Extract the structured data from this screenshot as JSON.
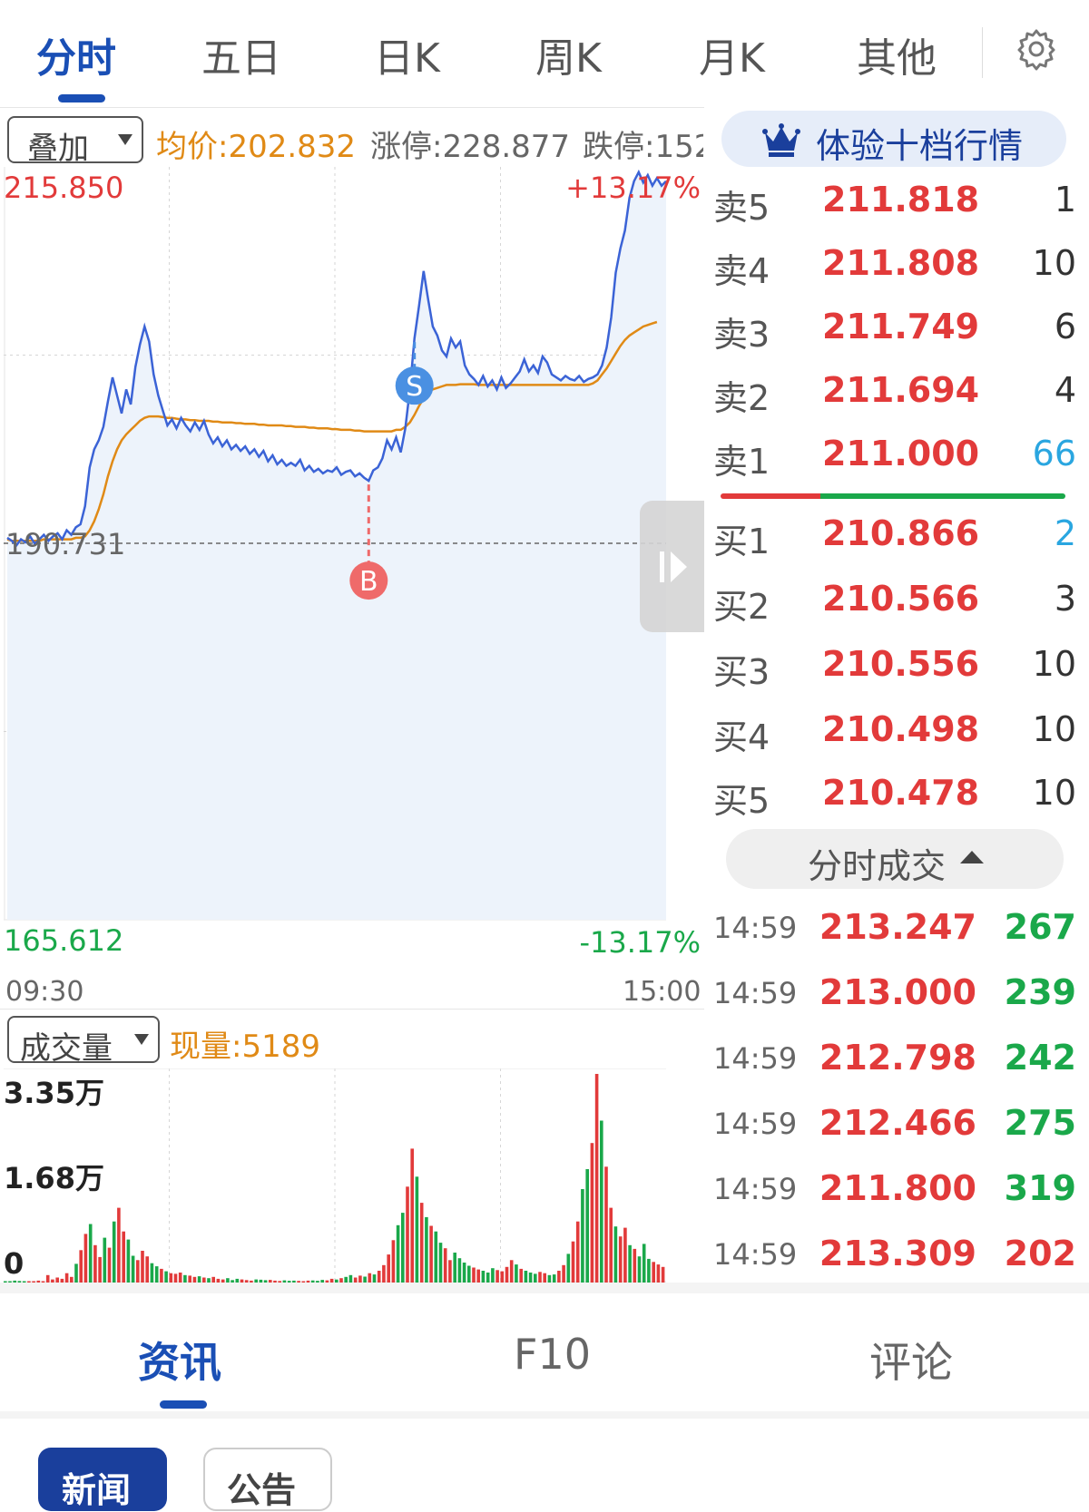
{
  "top_tabs": [
    {
      "label": "分时",
      "active": true
    },
    {
      "label": "五日",
      "active": false
    },
    {
      "label": "日K",
      "active": false
    },
    {
      "label": "周K",
      "active": false
    },
    {
      "label": "月K",
      "active": false
    },
    {
      "label": "其他",
      "active": false
    }
  ],
  "settings_icon": "gear-icon",
  "header": {
    "overlay_label": "叠加",
    "avg_price": "均价:202.832",
    "limit_up": "涨停:228.877",
    "limit_down": "跌停:152"
  },
  "colors": {
    "accent": "#1a4fb5",
    "up": "#e23a3a",
    "down": "#1aa84a",
    "avg_line": "#e08a16",
    "price_line": "#3b63d6"
  },
  "chart_data": [
    {
      "type": "line",
      "series": [
        {
          "role": "price",
          "values": [
            191.1,
            190.9,
            190.6,
            191.0,
            190.8,
            191.2,
            190.7,
            191.0,
            191.3,
            190.9,
            191.2,
            191.4,
            191.0,
            191.6,
            191.3,
            191.8,
            192.0,
            193.2,
            195.8,
            197.0,
            197.6,
            198.5,
            200.2,
            201.8,
            200.6,
            199.4,
            201.0,
            200.0,
            202.5,
            204.0,
            205.2,
            204.2,
            202.0,
            200.6,
            199.6,
            198.6,
            199.0,
            198.4,
            199.1,
            198.6,
            198.2,
            198.8,
            198.3,
            198.9,
            198.0,
            197.4,
            197.8,
            197.2,
            197.6,
            197.0,
            197.3,
            196.9,
            197.2,
            196.7,
            197.0,
            196.5,
            196.9,
            196.2,
            196.6,
            196.0,
            196.3,
            195.9,
            196.1,
            195.9,
            196.3,
            195.6,
            195.9,
            195.5,
            195.7,
            195.4,
            195.6,
            195.5,
            195.8,
            195.3,
            195.5,
            195.6,
            195.2,
            195.4,
            195.1,
            194.9,
            195.6,
            195.8,
            196.4,
            197.6,
            197.0,
            197.8,
            196.8,
            198.4,
            201.0,
            204.4,
            206.6,
            208.9,
            207.0,
            205.2,
            204.6,
            203.6,
            203.2,
            204.4,
            203.8,
            204.2,
            202.6,
            202.0,
            201.7,
            201.3,
            201.9,
            201.2,
            201.6,
            201.0,
            201.8,
            201.1,
            201.4,
            201.8,
            202.2,
            203.0,
            202.2,
            202.6,
            202.1,
            203.2,
            202.8,
            202.0,
            201.8,
            201.6,
            201.9,
            201.7,
            201.6,
            201.9,
            201.5,
            201.7,
            201.8,
            202.0,
            202.6,
            203.8,
            205.8,
            208.8,
            210.4,
            211.6,
            213.8,
            214.9,
            215.5,
            214.8,
            215.3,
            214.6,
            215.1,
            214.6,
            214.9
          ]
        },
        {
          "role": "average",
          "values": [
            191.0,
            190.9,
            190.9,
            190.9,
            190.9,
            190.9,
            190.9,
            190.9,
            191.0,
            191.0,
            191.0,
            191.0,
            191.0,
            191.0,
            191.0,
            191.1,
            191.1,
            191.2,
            191.6,
            192.2,
            193.0,
            194.0,
            195.2,
            196.2,
            197.0,
            197.6,
            198.0,
            198.3,
            198.6,
            198.9,
            199.1,
            199.2,
            199.2,
            199.2,
            199.15,
            199.1,
            199.1,
            199.05,
            199.0,
            199.0,
            198.95,
            198.95,
            198.9,
            198.9,
            198.9,
            198.85,
            198.85,
            198.8,
            198.8,
            198.8,
            198.75,
            198.75,
            198.7,
            198.7,
            198.7,
            198.65,
            198.65,
            198.6,
            198.6,
            198.6,
            198.6,
            198.55,
            198.55,
            198.5,
            198.5,
            198.5,
            198.45,
            198.45,
            198.4,
            198.4,
            198.4,
            198.35,
            198.35,
            198.3,
            198.3,
            198.3,
            198.25,
            198.25,
            198.2,
            198.2,
            198.2,
            198.2,
            198.2,
            198.2,
            198.2,
            198.3,
            198.3,
            198.5,
            198.8,
            199.3,
            199.9,
            200.4,
            200.8,
            201.0,
            201.1,
            201.2,
            201.3,
            201.3,
            201.3,
            201.35,
            201.35,
            201.35,
            201.35,
            201.3,
            201.3,
            201.3,
            201.3,
            201.3,
            201.3,
            201.3,
            201.3,
            201.3,
            201.3,
            201.3,
            201.3,
            201.3,
            201.3,
            201.3,
            201.3,
            201.3,
            201.3,
            201.3,
            201.3,
            201.3,
            201.3,
            201.3,
            201.3,
            201.3,
            201.4,
            201.6,
            202.0,
            202.4,
            202.9,
            203.4,
            203.9,
            204.3,
            204.6,
            204.8,
            205.0,
            205.2,
            205.3,
            205.4,
            205.5
          ]
        }
      ],
      "x_start_label": "09:30",
      "x_end_label": "15:00",
      "y_max_label": "215.850",
      "y_min_label": "165.612",
      "y_max_pct": "+13.17%",
      "y_min_pct": "-13.17%",
      "prev_close_label": "190.731",
      "ylim": [
        165.612,
        215.85
      ],
      "prev_close": 190.731,
      "markers": [
        {
          "label": "B",
          "index": 79,
          "color": "#ef6a6a",
          "direction": "below"
        },
        {
          "label": "S",
          "index": 89,
          "color": "#4a90e2",
          "direction": "below"
        }
      ]
    },
    {
      "type": "bar",
      "title": "成交量",
      "current_volume": "现量:5189",
      "y_labels": [
        "3.35万",
        "1.68万",
        "0"
      ],
      "ylim": [
        0,
        33500
      ],
      "values": [
        200,
        150,
        300,
        250,
        180,
        220,
        160,
        300,
        200,
        1200,
        500,
        800,
        600,
        1500,
        900,
        3000,
        5200,
        7800,
        9400,
        6000,
        4100,
        7200,
        5600,
        9800,
        12000,
        8200,
        6900,
        4300,
        3600,
        5100,
        4200,
        3100,
        2600,
        2200,
        1800,
        1500,
        1400,
        1600,
        1200,
        1100,
        900,
        1000,
        800,
        700,
        900,
        600,
        500,
        700,
        400,
        600,
        500,
        400,
        300,
        500,
        450,
        380,
        420,
        300,
        250,
        350,
        280,
        310,
        260,
        200,
        300,
        340,
        280,
        420,
        350,
        600,
        480,
        700,
        900,
        1200,
        800,
        1100,
        950,
        1500,
        1300,
        1900,
        2800,
        4500,
        6800,
        9200,
        11200,
        15400,
        21500,
        17000,
        12800,
        10500,
        9100,
        8200,
        6400,
        5500,
        3600,
        4800,
        3900,
        3200,
        2700,
        2400,
        2100,
        1900,
        1600,
        2300,
        2000,
        1800,
        2500,
        3600,
        2900,
        2200,
        1900,
        1600,
        1400,
        1700,
        1500,
        1200,
        1300,
        1900,
        2800,
        4600,
        6600,
        9800,
        15000,
        18200,
        22400,
        33500,
        26000,
        18600,
        12000,
        9000,
        7400,
        8800,
        6000,
        5400,
        4200,
        6200,
        3800,
        3300,
        2900,
        2500
      ],
      "colors_up_down": [
        "#1aa84a",
        "#e23a3a"
      ]
    }
  ],
  "level10_button": "体验十档行情",
  "order_book": {
    "asks": [
      {
        "label": "卖5",
        "price": "211.818",
        "vol": "1"
      },
      {
        "label": "卖4",
        "price": "211.808",
        "vol": "10"
      },
      {
        "label": "卖3",
        "price": "211.749",
        "vol": "6"
      },
      {
        "label": "卖2",
        "price": "211.694",
        "vol": "4"
      },
      {
        "label": "卖1",
        "price": "211.000",
        "vol": "66",
        "vol_color": "#2aa6e0"
      }
    ],
    "bids": [
      {
        "label": "买1",
        "price": "210.866",
        "vol": "2",
        "vol_color": "#2aa6e0"
      },
      {
        "label": "买2",
        "price": "210.566",
        "vol": "3"
      },
      {
        "label": "买3",
        "price": "210.556",
        "vol": "10"
      },
      {
        "label": "买4",
        "price": "210.498",
        "vol": "10"
      },
      {
        "label": "买5",
        "price": "210.478",
        "vol": "10"
      }
    ]
  },
  "ticks_toggle": "分时成交",
  "ticks": [
    {
      "time": "14:59",
      "price": "213.247",
      "vol": "267",
      "vol_color": "#1aa84a"
    },
    {
      "time": "14:59",
      "price": "213.000",
      "vol": "239",
      "vol_color": "#1aa84a"
    },
    {
      "time": "14:59",
      "price": "212.798",
      "vol": "242",
      "vol_color": "#1aa84a"
    },
    {
      "time": "14:59",
      "price": "212.466",
      "vol": "275",
      "vol_color": "#1aa84a"
    },
    {
      "time": "14:59",
      "price": "211.800",
      "vol": "319",
      "vol_color": "#1aa84a"
    },
    {
      "time": "14:59",
      "price": "213.309",
      "vol": "202",
      "vol_color": "#e23a3a"
    }
  ],
  "bottom_tabs": [
    {
      "label": "资讯",
      "active": true
    },
    {
      "label": "F10",
      "active": false
    },
    {
      "label": "评论",
      "active": false
    }
  ],
  "sub_tabs": [
    {
      "label": "新闻",
      "active": true
    },
    {
      "label": "公告",
      "active": false
    }
  ]
}
